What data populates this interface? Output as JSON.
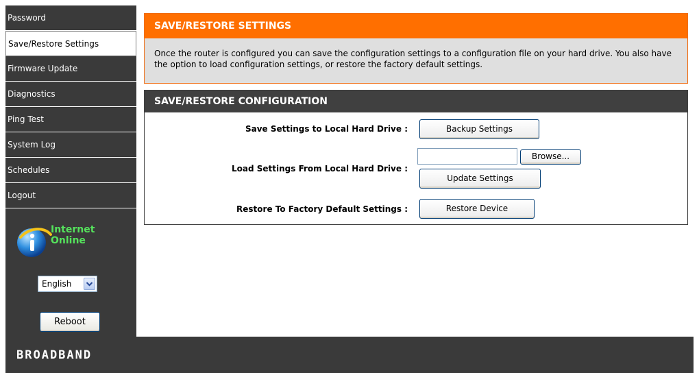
{
  "sidebar": {
    "items": [
      {
        "label": "Password"
      },
      {
        "label": "Save/Restore Settings",
        "active": true
      },
      {
        "label": "Firmware Update"
      },
      {
        "label": "Diagnostics"
      },
      {
        "label": "Ping Test"
      },
      {
        "label": "System Log"
      },
      {
        "label": "Schedules"
      },
      {
        "label": "Logout"
      }
    ],
    "status": {
      "line1": "Internet",
      "line2": "Online",
      "icon": "info-globe-icon"
    },
    "language": {
      "selected": "English"
    },
    "reboot_label": "Reboot"
  },
  "intro": {
    "title": "SAVE/RESTORE SETTINGS",
    "text": "Once the router is configured you can save the configuration settings to a configuration file on your hard drive. You also have the option to load configuration settings, or restore the factory default settings."
  },
  "config": {
    "title": "SAVE/RESTORE CONFIGURATION",
    "save_label": "Save Settings to Local Hard Drive :",
    "backup_button": "Backup Settings",
    "load_label": "Load Settings From Local Hard Drive :",
    "file_value": "",
    "browse_button": "Browse...",
    "update_button": "Update Settings",
    "restore_label": "Restore To Factory Default Settings :",
    "restore_button": "Restore Device"
  },
  "footer": {
    "brand": "BROADBAND"
  },
  "colors": {
    "accent": "#ff6f00",
    "dark": "#3a3a3a",
    "online": "#55e25c"
  }
}
